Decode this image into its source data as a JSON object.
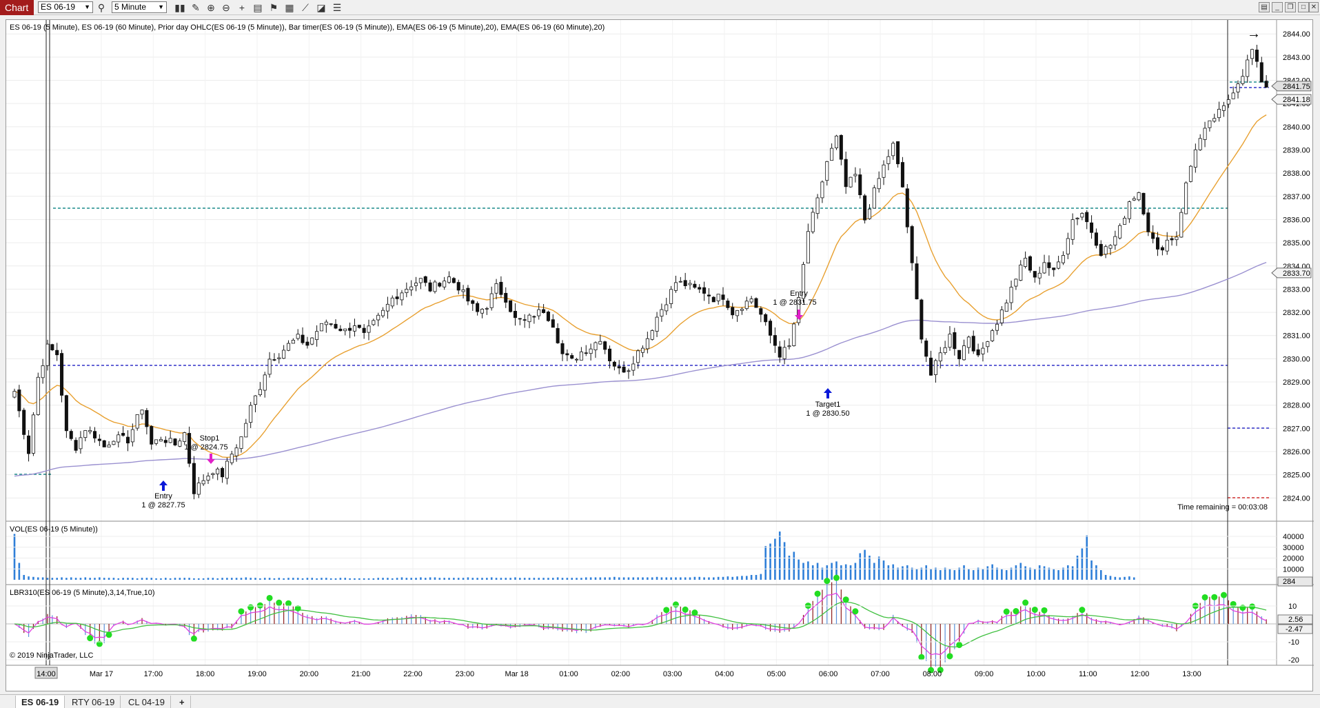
{
  "toolbar": {
    "chart_label": "Chart",
    "instrument": "ES 06-19",
    "interval": "5 Minute",
    "icons": [
      "search-icon",
      "bars-icon",
      "pencil-icon",
      "zoom-in-icon",
      "zoom-out-icon",
      "crosshair-icon",
      "properties-icon",
      "strategy-icon",
      "indicators-icon",
      "drawing-tool-icon",
      "templates-icon",
      "more-icon"
    ]
  },
  "window_controls": [
    "list-icon",
    "minimize-icon",
    "restore-icon",
    "maximize-icon",
    "close-icon"
  ],
  "price_panel": {
    "title": "ES 06-19 (5 Minute), ES 06-19 (60 Minute), Prior day OHLC(ES 06-19 (5 Minute)), Bar timer(ES 06-19 (5 Minute)), EMA(ES 06-19 (5 Minute),20), EMA(ES 06-19 (60 Minute),20)",
    "y_ticks": [
      "2844.00",
      "2843.00",
      "2842.00",
      "2841.00",
      "2840.00",
      "2839.00",
      "2838.00",
      "2837.00",
      "2836.00",
      "2835.00",
      "2834.00",
      "2833.00",
      "2832.00",
      "2831.00",
      "2830.00",
      "2829.00",
      "2828.00",
      "2827.00",
      "2826.00",
      "2825.00",
      "2824.00"
    ],
    "badges": [
      {
        "label": "2841.75",
        "price": 2841.75
      },
      {
        "label": "2841.18",
        "price": 2841.18
      },
      {
        "label": "2833.70",
        "price": 2833.7
      }
    ],
    "timer_text": "Time remaining = 00:03:08",
    "annotations": {
      "entry1_title": "Entry",
      "entry1_detail": "1 @ 2827.75",
      "stop1_title": "Stop1",
      "stop1_detail": "1 @ 2824.75",
      "entry2_title": "Entry",
      "entry2_detail": "1 @ 2831.75",
      "target1_title": "Target1",
      "target1_detail": "1 @ 2830.50"
    },
    "colors": {
      "ema5": "#e8a030",
      "ema60": "#9a90d0",
      "teal_line": "#1a8a8a",
      "blue_line": "#3030c8",
      "red_line": "#d03030",
      "up_arrow": "#0a18d8",
      "down_arrow": "#e020c8"
    }
  },
  "chart_data": {
    "type": "candlestick",
    "y_range": [
      2823.0,
      2844.6
    ],
    "x_labels": [
      "14:00",
      "Mar 17",
      "17:00",
      "18:00",
      "19:00",
      "20:00",
      "21:00",
      "22:00",
      "23:00",
      "Mar 18",
      "01:00",
      "02:00",
      "03:00",
      "04:00",
      "05:00",
      "06:00",
      "07:00",
      "08:00",
      "09:00",
      "10:00",
      "11:00",
      "12:00",
      "13:00"
    ],
    "close_path": [
      [
        0,
        2828.6
      ],
      [
        3,
        2826.0
      ],
      [
        5,
        2829.2
      ],
      [
        7,
        2830.5
      ],
      [
        9,
        2830.2
      ],
      [
        11,
        2826.8
      ],
      [
        13,
        2826.2
      ],
      [
        15,
        2827.0
      ],
      [
        17,
        2826.7
      ],
      [
        19,
        2826.2
      ],
      [
        21,
        2826.6
      ],
      [
        24,
        2826.5
      ],
      [
        27,
        2827.9
      ],
      [
        29,
        2826.3
      ],
      [
        31,
        2826.6
      ],
      [
        34,
        2826.3
      ],
      [
        36,
        2826.8
      ],
      [
        38,
        2824.3
      ],
      [
        40,
        2824.8
      ],
      [
        42,
        2825.2
      ],
      [
        44,
        2825.0
      ],
      [
        46,
        2825.9
      ],
      [
        48,
        2826.6
      ],
      [
        50,
        2827.9
      ],
      [
        52,
        2828.8
      ],
      [
        54,
        2830.0
      ],
      [
        56,
        2830.2
      ],
      [
        58,
        2830.6
      ],
      [
        60,
        2830.9
      ],
      [
        62,
        2830.6
      ],
      [
        64,
        2831.2
      ],
      [
        66,
        2831.6
      ],
      [
        68,
        2831.4
      ],
      [
        70,
        2831.2
      ],
      [
        72,
        2831.5
      ],
      [
        74,
        2831.0
      ],
      [
        76,
        2831.5
      ],
      [
        78,
        2832.0
      ],
      [
        80,
        2832.6
      ],
      [
        82,
        2832.9
      ],
      [
        84,
        2833.2
      ],
      [
        86,
        2833.4
      ],
      [
        88,
        2833.0
      ],
      [
        90,
        2833.3
      ],
      [
        92,
        2833.5
      ],
      [
        94,
        2833.1
      ],
      [
        96,
        2832.5
      ],
      [
        98,
        2832.0
      ],
      [
        100,
        2832.3
      ],
      [
        102,
        2833.1
      ],
      [
        104,
        2832.6
      ],
      [
        106,
        2831.7
      ],
      [
        108,
        2831.6
      ],
      [
        110,
        2831.9
      ],
      [
        112,
        2832.1
      ],
      [
        114,
        2831.5
      ],
      [
        116,
        2830.2
      ],
      [
        118,
        2829.9
      ],
      [
        120,
        2830.3
      ],
      [
        122,
        2830.5
      ],
      [
        124,
        2830.9
      ],
      [
        126,
        2830.0
      ],
      [
        128,
        2829.5
      ],
      [
        130,
        2829.6
      ],
      [
        132,
        2830.3
      ],
      [
        134,
        2830.9
      ],
      [
        136,
        2831.8
      ],
      [
        138,
        2832.5
      ],
      [
        140,
        2833.3
      ],
      [
        142,
        2833.2
      ],
      [
        144,
        2833.0
      ],
      [
        146,
        2832.9
      ],
      [
        148,
        2832.6
      ],
      [
        150,
        2832.7
      ],
      [
        152,
        2832.0
      ],
      [
        154,
        2832.3
      ],
      [
        156,
        2832.6
      ],
      [
        158,
        2831.9
      ],
      [
        160,
        2831.0
      ],
      [
        162,
        2830.2
      ],
      [
        164,
        2830.5
      ],
      [
        166,
        2832.5
      ],
      [
        168,
        2835.5
      ],
      [
        170,
        2836.8
      ],
      [
        172,
        2838.5
      ],
      [
        174,
        2839.5
      ],
      [
        176,
        2837.4
      ],
      [
        178,
        2837.9
      ],
      [
        180,
        2836.0
      ],
      [
        182,
        2837.2
      ],
      [
        184,
        2838.3
      ],
      [
        186,
        2839.2
      ],
      [
        188,
        2837.4
      ],
      [
        190,
        2834.0
      ],
      [
        192,
        2831.0
      ],
      [
        194,
        2829.3
      ],
      [
        196,
        2830.2
      ],
      [
        198,
        2831.0
      ],
      [
        200,
        2830.1
      ],
      [
        202,
        2831.0
      ],
      [
        204,
        2830.0
      ],
      [
        206,
        2830.9
      ],
      [
        208,
        2831.6
      ],
      [
        210,
        2832.5
      ],
      [
        212,
        2833.5
      ],
      [
        214,
        2834.3
      ],
      [
        216,
        2833.4
      ],
      [
        218,
        2834.2
      ],
      [
        220,
        2833.7
      ],
      [
        222,
        2834.6
      ],
      [
        224,
        2836.0
      ],
      [
        226,
        2836.3
      ],
      [
        228,
        2835.5
      ],
      [
        230,
        2834.6
      ],
      [
        232,
        2834.9
      ],
      [
        234,
        2835.6
      ],
      [
        236,
        2836.8
      ],
      [
        238,
        2837.2
      ],
      [
        240,
        2835.6
      ],
      [
        242,
        2834.6
      ],
      [
        244,
        2835.1
      ],
      [
        246,
        2835.3
      ],
      [
        248,
        2837.5
      ],
      [
        250,
        2839.1
      ],
      [
        252,
        2839.8
      ],
      [
        254,
        2840.4
      ],
      [
        256,
        2840.8
      ],
      [
        258,
        2841.6
      ],
      [
        260,
        2842.3
      ],
      [
        262,
        2843.3
      ],
      [
        264,
        2842.0
      ],
      [
        265,
        2841.75
      ]
    ]
  },
  "volume_panel": {
    "title": "VOL(ES 06-19 (5 Minute))",
    "y_ticks": [
      "40000",
      "30000",
      "20000",
      "10000"
    ],
    "badge": "284",
    "bars": [
      0.95,
      0.35,
      0.1,
      0.07,
      0.06,
      0.05,
      0.05,
      0.04,
      0.04,
      0.04,
      0.05,
      0.04,
      0.05,
      0.04,
      0.04,
      0.05,
      0.04,
      0.04,
      0.05,
      0.04,
      0.04,
      0.04,
      0.03,
      0.04,
      0.04,
      0.04,
      0.03,
      0.04,
      0.04,
      0.04,
      0.03,
      0.03,
      0.04,
      0.03,
      0.04,
      0.04,
      0.04,
      0.04,
      0.03,
      0.03,
      0.03,
      0.04,
      0.04,
      0.03,
      0.04,
      0.04,
      0.04,
      0.04,
      0.04,
      0.05,
      0.04,
      0.04,
      0.03,
      0.04,
      0.04,
      0.03,
      0.04,
      0.03,
      0.04,
      0.04,
      0.04,
      0.03,
      0.04,
      0.04,
      0.03,
      0.04,
      0.04,
      0.03,
      0.03,
      0.04,
      0.04,
      0.03,
      0.03,
      0.03,
      0.03,
      0.03,
      0.03,
      0.04,
      0.04,
      0.04,
      0.03,
      0.04,
      0.05,
      0.04,
      0.04,
      0.04,
      0.05,
      0.04,
      0.05,
      0.05,
      0.04,
      0.04,
      0.04,
      0.04,
      0.04,
      0.04,
      0.05,
      0.04,
      0.04,
      0.04,
      0.04,
      0.05,
      0.04,
      0.04,
      0.04,
      0.04,
      0.05,
      0.04,
      0.04,
      0.04,
      0.04,
      0.04,
      0.04,
      0.04,
      0.04,
      0.05,
      0.04,
      0.04,
      0.04,
      0.04,
      0.04,
      0.05,
      0.05,
      0.05,
      0.05,
      0.05,
      0.05,
      0.06,
      0.05,
      0.05,
      0.05,
      0.05,
      0.05,
      0.05,
      0.05,
      0.05,
      0.06,
      0.05,
      0.05,
      0.05,
      0.05,
      0.05,
      0.05,
      0.05,
      0.06,
      0.06,
      0.05,
      0.05,
      0.05,
      0.06,
      0.06,
      0.07,
      0.06,
      0.07,
      0.08,
      0.08,
      0.1,
      0.1,
      0.12,
      0.7,
      0.75,
      0.85,
      1.0,
      0.78,
      0.5,
      0.58,
      0.42,
      0.35,
      0.38,
      0.3,
      0.35,
      0.25,
      0.3,
      0.35,
      0.38,
      0.3,
      0.32,
      0.3,
      0.35,
      0.55,
      0.62,
      0.5,
      0.35,
      0.48,
      0.4,
      0.3,
      0.32,
      0.25,
      0.28,
      0.3,
      0.25,
      0.22,
      0.25,
      0.3,
      0.22,
      0.25,
      0.2,
      0.25,
      0.22,
      0.2,
      0.25,
      0.3,
      0.22,
      0.2,
      0.25,
      0.22,
      0.28,
      0.32,
      0.25,
      0.22,
      0.2,
      0.25,
      0.3,
      0.35,
      0.28,
      0.25,
      0.22,
      0.3,
      0.28,
      0.25,
      0.22,
      0.2,
      0.25,
      0.3,
      0.28,
      0.5,
      0.65,
      0.92,
      0.4,
      0.3,
      0.2,
      0.1,
      0.08,
      0.06,
      0.05,
      0.06,
      0.07,
      0.05
    ]
  },
  "lbr_panel": {
    "title": "LBR310(ES 06-19 (5 Minute),3,14,True,10)",
    "y_ticks": [
      "10",
      "-10",
      "-20"
    ],
    "badges": [
      "2.56",
      "-2.47"
    ],
    "copyright": "© 2019 NinjaTrader, LLC"
  },
  "tabs": [
    {
      "label": "ES 06-19",
      "active": true
    },
    {
      "label": "RTY 06-19",
      "active": false
    },
    {
      "label": "CL 04-19",
      "active": false
    }
  ],
  "add_tab_label": "+"
}
